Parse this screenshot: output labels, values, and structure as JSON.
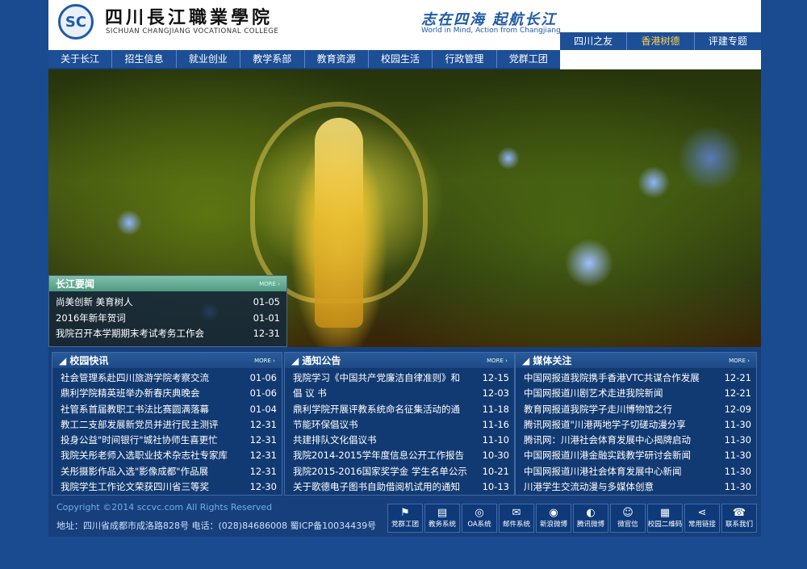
{
  "header": {
    "logo_mark": "SC",
    "school_cn": "四川長江職業學院",
    "school_en": "SICHUAN CHANGJIANG VOCATIONAL COLLEGE",
    "slogan_cn": "志在四海 起航长江",
    "slogan_en": "World in Mind, Action from Changjiang"
  },
  "subnav": [
    "四川之友",
    "香港树德",
    "评建专题"
  ],
  "nav": [
    "关于长江",
    "招生信息",
    "就业创业",
    "教学系部",
    "教育资源",
    "校园生活",
    "行政管理",
    "党群工团"
  ],
  "news": {
    "title": "长江要闻",
    "more": "MORE ›",
    "items": [
      {
        "t": "尚美创新 美育树人",
        "d": "01-05"
      },
      {
        "t": "2016年新年贺词",
        "d": "01-01"
      },
      {
        "t": "我院召开本学期期末考试考务工作会",
        "d": "12-31"
      }
    ]
  },
  "campus": {
    "title": "校园快讯",
    "more": "MORE ›",
    "items": [
      {
        "t": "社会管理系赴四川旅游学院考察交流",
        "d": "01-06"
      },
      {
        "t": "鼎利学院精英班举办新春庆典晚会",
        "d": "01-06"
      },
      {
        "t": "社管系首届教职工书法比赛圆满落幕",
        "d": "01-04"
      },
      {
        "t": "教工二支部发展新党员并进行民主测评",
        "d": "12-31"
      },
      {
        "t": "投身公益\"时间银行\"城社协师生喜更忙",
        "d": "12-31"
      },
      {
        "t": "我院关彤老师入选职业技术杂志社专家库",
        "d": "12-31"
      },
      {
        "t": "关彤摄影作品入选\"影像成都\"作品展",
        "d": "12-31"
      },
      {
        "t": "我院学生工作论文荣获四川省三等奖",
        "d": "12-30"
      }
    ]
  },
  "notice": {
    "title": "通知公告",
    "more": "MORE ›",
    "items": [
      {
        "t": "我院学习《中国共产党廉洁自律准则》和",
        "d": "12-15"
      },
      {
        "t": "倡 议 书",
        "d": "12-03"
      },
      {
        "t": "鼎利学院开展评教系统命名征集活动的通",
        "d": "11-18"
      },
      {
        "t": "节能环保倡议书",
        "d": "11-16"
      },
      {
        "t": "共建排队文化倡议书",
        "d": "11-10"
      },
      {
        "t": "我院2014-2015学年度信息公开工作报告",
        "d": "10-30"
      },
      {
        "t": "我院2015-2016国家奖学金 学生名单公示",
        "d": "10-21"
      },
      {
        "t": "关于歌德电子图书自助借阅机试用的通知",
        "d": "10-13"
      }
    ]
  },
  "media": {
    "title": "媒体关注",
    "more": "MORE ›",
    "items": [
      {
        "t": "中国网报道我院携手香港VTC共谋合作发展",
        "d": "12-21"
      },
      {
        "t": "中国网报道川剧艺术走进我院新闻",
        "d": "12-21"
      },
      {
        "t": "教育网报道我院学子走川博物馆之行",
        "d": "12-09"
      },
      {
        "t": "腾讯网报道\"川港两地学子切磋动漫分享",
        "d": "11-30"
      },
      {
        "t": "腾讯网：川港社会体育发展中心揭牌启动",
        "d": "11-30"
      },
      {
        "t": "中国网报道川港金融实践教学研讨会新闻",
        "d": "11-30"
      },
      {
        "t": "中国网报道川港社会体育发展中心新闻",
        "d": "11-30"
      },
      {
        "t": "川港学生交流动漫与多媒体创意",
        "d": "11-30"
      }
    ]
  },
  "footer": {
    "copyright": "Copyright ©2014 sccvc.com All Rights Reserved",
    "address": "地址：四川省成都市成洛路828号 电话：(028)84686008 蜀ICP备10034439号"
  },
  "quicklinks": [
    {
      "g": "⚑",
      "l": "党群工团",
      "icon": "org-chart-icon"
    },
    {
      "g": "▤",
      "l": "教务系统",
      "icon": "document-icon"
    },
    {
      "g": "◎",
      "l": "OA系统",
      "icon": "oa-icon"
    },
    {
      "g": "✉",
      "l": "邮件系统",
      "icon": "mail-icon"
    },
    {
      "g": "◉",
      "l": "新浪微博",
      "icon": "weibo-icon"
    },
    {
      "g": "◐",
      "l": "腾讯微博",
      "icon": "tencent-weibo-icon"
    },
    {
      "g": "☺",
      "l": "微官信",
      "icon": "wechat-icon"
    },
    {
      "g": "▦",
      "l": "校园二维码",
      "icon": "qrcode-icon"
    },
    {
      "g": "⋖",
      "l": "常用链接",
      "icon": "share-icon"
    },
    {
      "g": "☎",
      "l": "联系我们",
      "icon": "contact-icon"
    }
  ]
}
